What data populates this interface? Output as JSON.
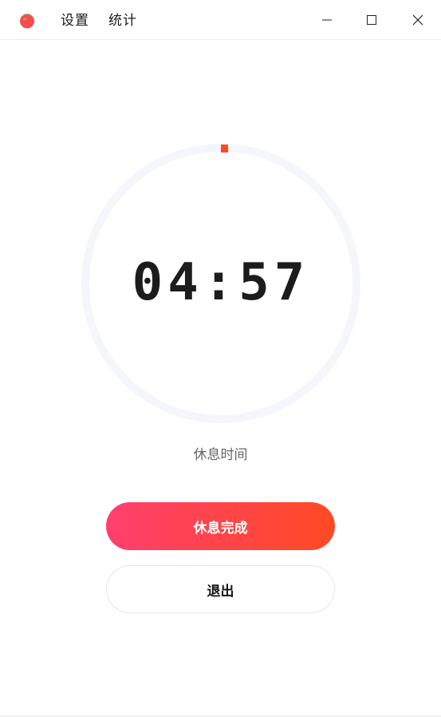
{
  "menu": {
    "settings": "设置",
    "stats": "统计"
  },
  "window_controls": {
    "minimize_icon": "minimize-icon",
    "maximize_icon": "maximize-icon",
    "close_icon": "close-icon"
  },
  "timer": {
    "display": "04:57",
    "progress": 0.0,
    "phase_label": "休息时间"
  },
  "buttons": {
    "primary_label": "休息完成",
    "secondary_label": "退出"
  },
  "colors": {
    "accent_start": "#ff3f6e",
    "accent_end": "#ff4a24",
    "ring_track": "#f5f6fb",
    "progress_marker": "#ff4a24"
  }
}
